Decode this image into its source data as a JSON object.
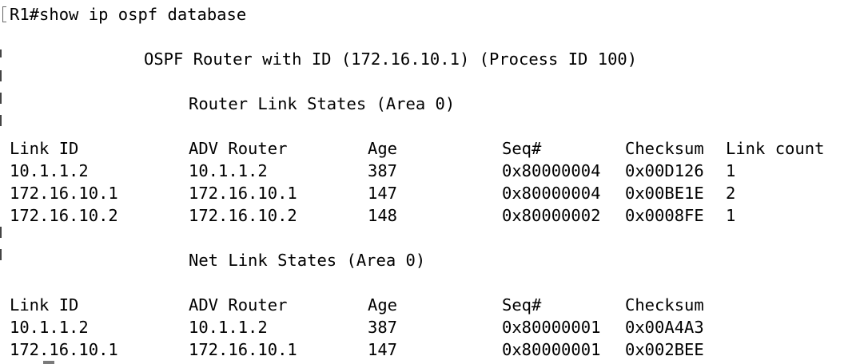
{
  "terminal": {
    "prompt_line": "R1#show ip ospf database",
    "router_header": "OSPF Router with ID (172.16.10.1) (Process ID 100)",
    "router_section": {
      "title": "Router Link States (Area 0)",
      "headers": {
        "link_id": "Link ID",
        "adv_router": "ADV Router",
        "age": "Age",
        "seq": "Seq#",
        "checksum": "Checksum",
        "link_count": "Link count"
      },
      "rows": [
        {
          "link_id": "10.1.1.2",
          "adv_router": "10.1.1.2",
          "age": "387",
          "seq": "0x80000004",
          "checksum": "0x00D126",
          "link_count": "1"
        },
        {
          "link_id": "172.16.10.1",
          "adv_router": "172.16.10.1",
          "age": "147",
          "seq": "0x80000004",
          "checksum": "0x00BE1E",
          "link_count": "2"
        },
        {
          "link_id": "172.16.10.2",
          "adv_router": "172.16.10.2",
          "age": "148",
          "seq": "0x80000002",
          "checksum": "0x0008FE",
          "link_count": "1"
        }
      ]
    },
    "net_section": {
      "title": "Net Link States (Area 0)",
      "headers": {
        "link_id": "Link ID",
        "adv_router": "ADV Router",
        "age": "Age",
        "seq": "Seq#",
        "checksum": "Checksum"
      },
      "rows": [
        {
          "link_id": "10.1.1.2",
          "adv_router": "10.1.1.2",
          "age": "387",
          "seq": "0x80000001",
          "checksum": "0x00A4A3"
        },
        {
          "link_id": "172.16.10.1",
          "adv_router": "172.16.10.1",
          "age": "147",
          "seq": "0x80000001",
          "checksum": "0x002BEE"
        }
      ]
    }
  }
}
